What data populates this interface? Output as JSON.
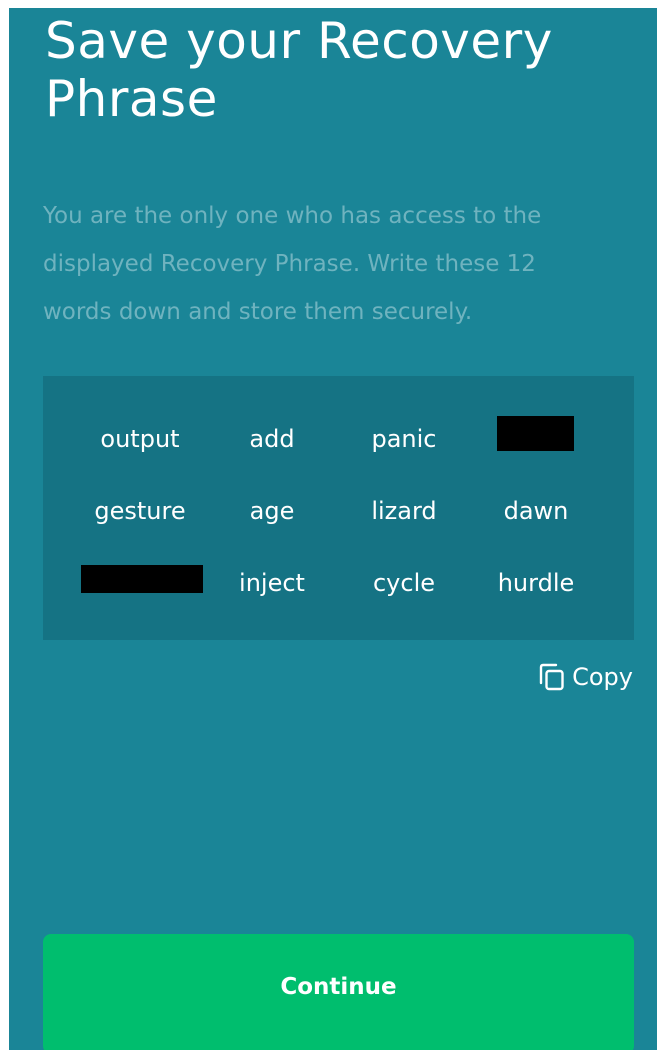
{
  "header": {
    "title_line1": "Save your Recovery",
    "title_line2": "Phrase"
  },
  "description": {
    "line1": "You are the only one who has access to the",
    "line2": "displayed Recovery Phrase. Write these 12",
    "line3": "words down and store them securely."
  },
  "phrase": {
    "word_count": 12,
    "words": [
      {
        "index": 1,
        "text": "output",
        "redacted": false
      },
      {
        "index": 2,
        "text": "add",
        "redacted": false
      },
      {
        "index": 3,
        "text": "panic",
        "redacted": false
      },
      {
        "index": 4,
        "text": "",
        "redacted": true
      },
      {
        "index": 5,
        "text": "gesture",
        "redacted": false
      },
      {
        "index": 6,
        "text": "age",
        "redacted": false
      },
      {
        "index": 7,
        "text": "lizard",
        "redacted": false
      },
      {
        "index": 8,
        "text": "dawn",
        "redacted": false
      },
      {
        "index": 9,
        "text": "",
        "redacted": true
      },
      {
        "index": 10,
        "text": "inject",
        "redacted": false
      },
      {
        "index": 11,
        "text": "cycle",
        "redacted": false
      },
      {
        "index": 12,
        "text": "hurdle",
        "redacted": false
      }
    ]
  },
  "actions": {
    "copy_label": "Copy",
    "copy_icon": "copy-icon",
    "continue_label": "Continue"
  },
  "colors": {
    "background": "#1a8597",
    "phrase_box": "#157384",
    "description_text": "#6fb3bf",
    "continue_button": "#00be6e",
    "redaction": "#000000",
    "text": "#ffffff"
  }
}
